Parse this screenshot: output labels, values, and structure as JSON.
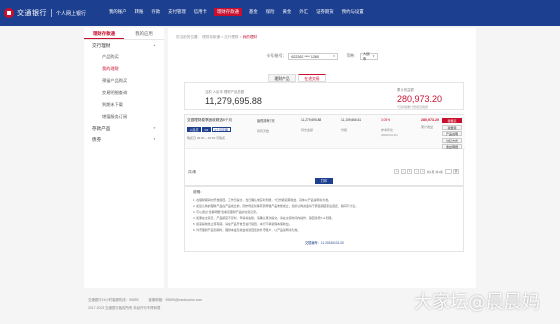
{
  "header": {
    "logo_text": "交通银行",
    "logo_sub": "个人网上银行",
    "nav": [
      "我的账户",
      "转账",
      "存款",
      "支付管理",
      "信用卡",
      "理财存款通",
      "基金",
      "保险",
      "黄金",
      "外汇",
      "证券期货",
      "预约与设置"
    ],
    "active_nav_index": 5
  },
  "sidebar": {
    "tabs": [
      "理财存款通",
      "我的应用"
    ],
    "groups": [
      {
        "label": "交行理财",
        "items": [
          "产品购买",
          "我的理财",
          "预留产品购买",
          "交易明细查询",
          "到期未下载",
          "增值服务订阅"
        ]
      },
      {
        "label": "存款产品",
        "items": []
      },
      {
        "label": "债券",
        "items": []
      }
    ],
    "active_item": "我的理财"
  },
  "breadcrumb": {
    "items": [
      "您当前的位置：",
      "理财存款通",
      "交行理财",
      "我的理财"
    ],
    "separator": " > "
  },
  "card_select": {
    "label": "卡号/账号：",
    "value": "622262 **** 1260",
    "currency_label": "币种：",
    "currency_value": "人民币"
  },
  "tabs": [
    "理财产品",
    "在途交易"
  ],
  "summary": {
    "left_label": "当前 人民币 理财产品总额",
    "left_value": "11,279,695.88",
    "right_label": "累计收益额",
    "right_value": "280,973.20",
    "right_note": "*已扣除累计费用及税费"
  },
  "product": {
    "name": "交银理财稳享固收精选6个月",
    "badges": [
      "人民币",
      "R2",
      "6个月定期"
    ],
    "time": "购买日 06:00 ~ 23:59 可购买",
    "col1_top": "最低持有7天",
    "col1_sub": "持有天数",
    "col2_top": "11,279,695.88",
    "col2_sub": "持仓金额",
    "col3_top": "11,109,666.61",
    "col3_sub": "份额",
    "col4_top": "3.05%",
    "col4_sub": "参考年化",
    "col4_sub2": "(2023.03.11)",
    "right_value": "280,973.20",
    "right_sub": "累计收益",
    "buttons": [
      "我要买",
      "我要卖",
      "产品说明",
      "分红方式",
      "收益明细",
      "更多"
    ]
  },
  "pagination": {
    "left": "共1条",
    "page": "1",
    "total_text": "共1页 共1条",
    "go_label": "跳"
  },
  "print_label": "打印",
  "notes": {
    "title": "说明：",
    "items": [
      "1. 在理财期间内开放赎回，工作日提交，当日确认或实时到账，T日份额起算收益，具体以产品说明书为准。",
      "2. 如您认购的理财产品在产品成立前，因市场变化等原因导致产品未能成立，您的认购资金将于募集期结束后退还，期间不计息。",
      "3. 可以通过“查看明细”查看该理财产品的交易记录。",
      "4. 如果在交易日，产品额度不足时，申请将失败，请确认再次提交，请在交易时间内操作，赎回款项T+1到账。",
      "5. 如需提前终止持有期，请在产品开放日进行赎回，本行不承诺保本保收益。",
      "6. 外币理财产品到期时，理财本金及收益将划回您的外币账户，以产品说明书为准。"
    ],
    "link": "交银编号：11.20240101.00"
  },
  "footer": {
    "line1_left": "交通银行24小时客服热线：95559",
    "line1_right": "客服邮箱：95559@bankcomm.com",
    "line2": "2017-2023 交通银行版权所有 未经许可不得转载"
  },
  "watermark": "大家坛@晨晨妈"
}
